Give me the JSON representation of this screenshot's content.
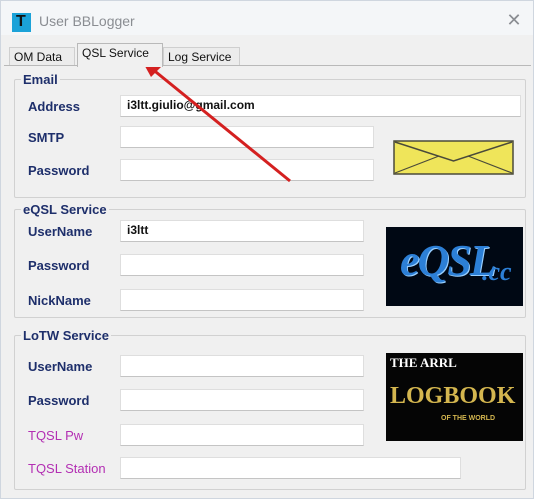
{
  "window": {
    "title": "User BBLogger"
  },
  "tabs": [
    {
      "label": "OM Data"
    },
    {
      "label": "QSL Service"
    },
    {
      "label": "Log Service"
    }
  ],
  "email": {
    "legend": "Email",
    "address_label": "Address",
    "address_value": "i3ltt.giulio@gmail.com",
    "smtp_label": "SMTP",
    "smtp_value": "",
    "password_label": "Password",
    "password_value": ""
  },
  "eqsl": {
    "legend": "eQSL Service",
    "username_label": "UserName",
    "username_value": "i3ltt",
    "password_label": "Password",
    "password_value": "",
    "nickname_label": "NickName",
    "nickname_value": "",
    "logo_text": "eQSL",
    "logo_suffix": ".cc"
  },
  "lotw": {
    "legend": "LoTW Service",
    "username_label": "UserName",
    "username_value": "",
    "password_label": "Password",
    "password_value": "",
    "tqsl_pw_label": "TQSL Pw",
    "tqsl_pw_value": "",
    "tqsl_station_label": "TQSL Station",
    "tqsl_station_value": "",
    "logo_top": "THE ARRL",
    "logo_main": "LOGBOOK",
    "logo_sub": "OF THE WORLD"
  },
  "colors": {
    "label_blue": "#1e2f6b",
    "label_pink": "#b32fb3",
    "arrow_red": "#d42020",
    "envelope_yellow": "#efe55a"
  }
}
